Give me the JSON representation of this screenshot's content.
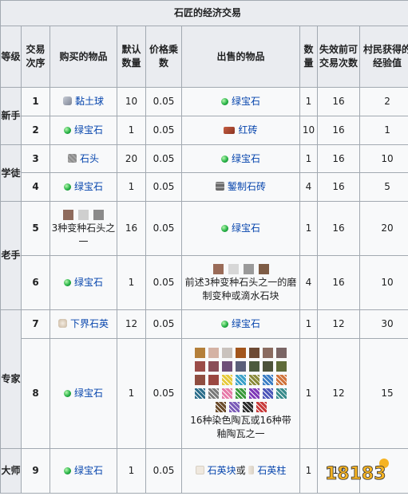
{
  "caption": "石匠的经济交易",
  "headers": {
    "level": "等级",
    "order": "交易次序",
    "buy": "购买的物品",
    "default_qty": "默认数量",
    "multiplier": "价格乘数",
    "sell": "出售的物品",
    "qty": "数量",
    "max_uses": "失效前可交易次数",
    "xp": "村民获得的经验值"
  },
  "levels": {
    "novice": "新手",
    "apprentice": "学徒",
    "journeyman": "老手",
    "expert": "专家",
    "master": "大师"
  },
  "rows": [
    {
      "no": "1",
      "buy": "黏土球",
      "dq": "10",
      "mult": "0.05",
      "sell": "绿宝石",
      "qty": "1",
      "uses": "16",
      "xp": "2"
    },
    {
      "no": "2",
      "buy": "绿宝石",
      "dq": "1",
      "mult": "0.05",
      "sell": "红砖",
      "qty": "10",
      "uses": "16",
      "xp": "1"
    },
    {
      "no": "3",
      "buy": "石头",
      "dq": "20",
      "mult": "0.05",
      "sell": "绿宝石",
      "qty": "1",
      "uses": "16",
      "xp": "10"
    },
    {
      "no": "4",
      "buy": "绿宝石",
      "dq": "1",
      "mult": "0.05",
      "sell": "錾制石砖",
      "qty": "4",
      "uses": "16",
      "xp": "5"
    },
    {
      "no": "5",
      "buy": "3种变种石头之一",
      "dq": "16",
      "mult": "0.05",
      "sell": "绿宝石",
      "qty": "1",
      "uses": "16",
      "xp": "20"
    },
    {
      "no": "6",
      "buy": "绿宝石",
      "dq": "1",
      "mult": "0.05",
      "sell": "前述3种变种石头之一的磨制变种或滴水石块",
      "qty": "4",
      "uses": "16",
      "xp": "10"
    },
    {
      "no": "7",
      "buy": "下界石英",
      "dq": "12",
      "mult": "0.05",
      "sell": "绿宝石",
      "qty": "1",
      "uses": "12",
      "xp": "30"
    },
    {
      "no": "8",
      "buy": "绿宝石",
      "dq": "1",
      "mult": "0.05",
      "sell": "16种染色陶瓦或16种带釉陶瓦之一",
      "qty": "1",
      "uses": "12",
      "xp": "15"
    },
    {
      "no": "9",
      "buy": "绿宝石",
      "dq": "1",
      "mult": "0.05",
      "sell_a": "石英块",
      "sell_or": "或",
      "sell_b": "石英柱",
      "qty": "1",
      "uses": "12",
      "xp": ""
    }
  ],
  "terracotta_colors": [
    "#b47f3a",
    "#d4b2a4",
    "#c9c2bd",
    "#a2551c",
    "#6d4a34",
    "#8a6b60",
    "#7a6565",
    "#9b4c48",
    "#8a4e58",
    "#6e4f78",
    "#5a5f7a",
    "#4c5b3e",
    "#4d523a",
    "#5f6b39",
    "#8f4d40",
    "#9a4741"
  ],
  "glazed_colors": [
    "#e6c93a",
    "#3aa0c8",
    "#8a8a3a",
    "#3b7dc4",
    "#d0733a",
    "#2c6e8b",
    "#7a7a7a",
    "#e67aa8",
    "#3a9a3a",
    "#7f3ab8",
    "#4b55b8",
    "#3a8c8c",
    "#6a4a2a",
    "#7a5ab8",
    "#2b2b2b",
    "#c83a3a"
  ],
  "stone_variant_colors": [
    "#8e6a5c",
    "#cfcfcf",
    "#8a8a8a"
  ],
  "polished_variant_colors": [
    "#9a6b58",
    "#d7d7d7",
    "#9a9a9a",
    "#7e5c45"
  ],
  "watermark": "18183",
  "colors": {
    "header_bg": "#eaecf0",
    "cell_bg": "#f8f9fa",
    "border": "#a2a9b1",
    "link": "#0645ad"
  }
}
